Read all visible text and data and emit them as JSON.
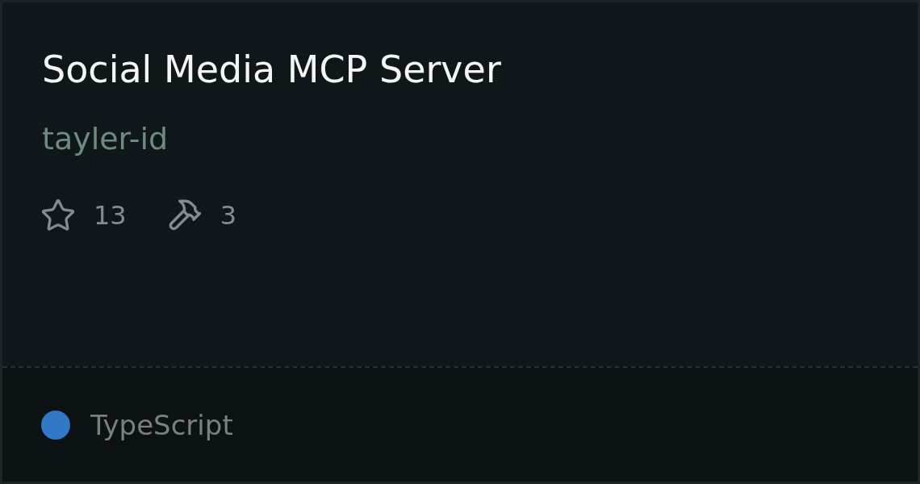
{
  "card": {
    "title": "Social Media MCP Server",
    "author": "tayler-id",
    "stats": [
      {
        "kind": "stars",
        "value": "13"
      },
      {
        "kind": "tools",
        "value": "3"
      }
    ],
    "language": {
      "name": "TypeScript",
      "color": "#3178c6"
    }
  }
}
